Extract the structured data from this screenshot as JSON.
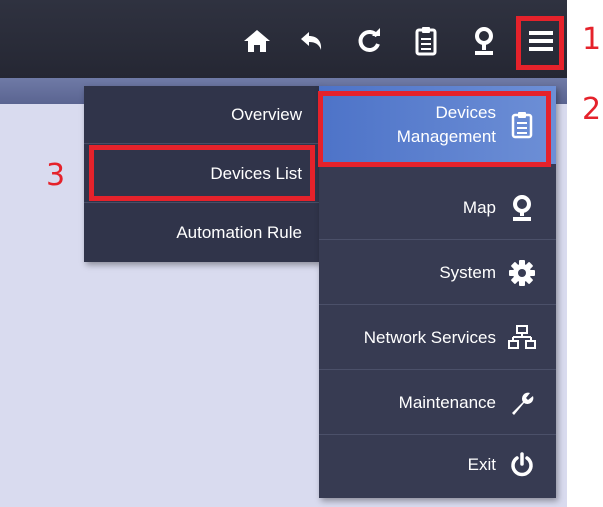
{
  "toolbar": {
    "icons": [
      "home-icon",
      "undo-icon",
      "refresh-icon",
      "clipboard-icon",
      "map-pin-icon",
      "hamburger-menu-icon"
    ]
  },
  "submenu": {
    "items": [
      {
        "label": "Overview"
      },
      {
        "label": "Devices List"
      },
      {
        "label": "Automation Rule"
      }
    ]
  },
  "main_menu": {
    "items": [
      {
        "label_line1": "Devices",
        "label_line2": "Management",
        "icon": "clipboard-icon",
        "active": true
      },
      {
        "label": "Map",
        "icon": "map-pin-icon"
      },
      {
        "label": "System",
        "icon": "gear-icon"
      },
      {
        "label": "Network Services",
        "icon": "network-icon"
      },
      {
        "label": "Maintenance",
        "icon": "wrench-icon"
      },
      {
        "label": "Exit",
        "icon": "power-icon"
      }
    ]
  },
  "callouts": {
    "menu_button": "1",
    "devices_management": "2",
    "devices_list": "3"
  },
  "colors": {
    "highlight": "#e5222b",
    "active_item": "#5b7fcf",
    "menu_bg": "#373b52",
    "topbar_bg": "#2a2d3a"
  }
}
